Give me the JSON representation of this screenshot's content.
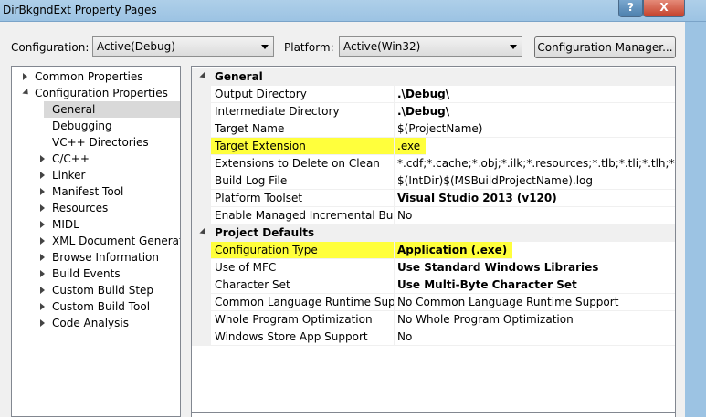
{
  "window": {
    "title": "DirBkgndExt Property Pages",
    "help_label": "?",
    "close_label": "X"
  },
  "top": {
    "configuration_label": "Configuration:",
    "configuration_value": "Active(Debug)",
    "platform_label": "Platform:",
    "platform_value": "Active(Win32)",
    "config_manager_label": "Configuration Manager..."
  },
  "tree": {
    "items": [
      {
        "label": "Common Properties",
        "state": "collapsed"
      },
      {
        "label": "Configuration Properties",
        "state": "expanded"
      },
      {
        "label": "General",
        "state": "leaf",
        "selected": true
      },
      {
        "label": "Debugging",
        "state": "leaf"
      },
      {
        "label": "VC++ Directories",
        "state": "leaf"
      },
      {
        "label": "C/C++",
        "state": "collapsed"
      },
      {
        "label": "Linker",
        "state": "collapsed"
      },
      {
        "label": "Manifest Tool",
        "state": "collapsed"
      },
      {
        "label": "Resources",
        "state": "collapsed"
      },
      {
        "label": "MIDL",
        "state": "collapsed"
      },
      {
        "label": "XML Document Generator",
        "state": "collapsed"
      },
      {
        "label": "Browse Information",
        "state": "collapsed"
      },
      {
        "label": "Build Events",
        "state": "collapsed"
      },
      {
        "label": "Custom Build Step",
        "state": "collapsed"
      },
      {
        "label": "Custom Build Tool",
        "state": "collapsed"
      },
      {
        "label": "Code Analysis",
        "state": "collapsed"
      }
    ]
  },
  "grid": {
    "general": {
      "category": "General",
      "rows": [
        {
          "name": "Output Directory",
          "value": ".\\Debug\\",
          "bold": true
        },
        {
          "name": "Intermediate Directory",
          "value": ".\\Debug\\",
          "bold": true
        },
        {
          "name": "Target Name",
          "value": "$(ProjectName)",
          "bold": false
        },
        {
          "name": "Target Extension",
          "value": ".exe",
          "bold": false,
          "highlight": true
        },
        {
          "name": "Extensions to Delete on Clean",
          "value": "*.cdf;*.cache;*.obj;*.ilk;*.resources;*.tlb;*.tli;*.tlh;*.tmp;*.rsp",
          "bold": false
        },
        {
          "name": "Build Log File",
          "value": "$(IntDir)$(MSBuildProjectName).log",
          "bold": false
        },
        {
          "name": "Platform Toolset",
          "value": "Visual Studio 2013 (v120)",
          "bold": true
        },
        {
          "name": "Enable Managed Incremental Build",
          "value": "No",
          "bold": false
        }
      ]
    },
    "project_defaults": {
      "category": "Project Defaults",
      "rows": [
        {
          "name": "Configuration Type",
          "value": "Application (.exe)",
          "bold": true,
          "highlight": true
        },
        {
          "name": "Use of MFC",
          "value": "Use Standard Windows Libraries",
          "bold": true
        },
        {
          "name": "Character Set",
          "value": "Use Multi-Byte Character Set",
          "bold": true
        },
        {
          "name": "Common Language Runtime Support",
          "value": "No Common Language Runtime Support",
          "bold": false
        },
        {
          "name": "Whole Program Optimization",
          "value": "No Whole Program Optimization",
          "bold": false
        },
        {
          "name": "Windows Store App Support",
          "value": "No",
          "bold": false
        }
      ]
    }
  },
  "colors": {
    "highlight": "#ffff3c",
    "selection": "#d9d9d9",
    "titlebar": "#9cc3e3"
  }
}
